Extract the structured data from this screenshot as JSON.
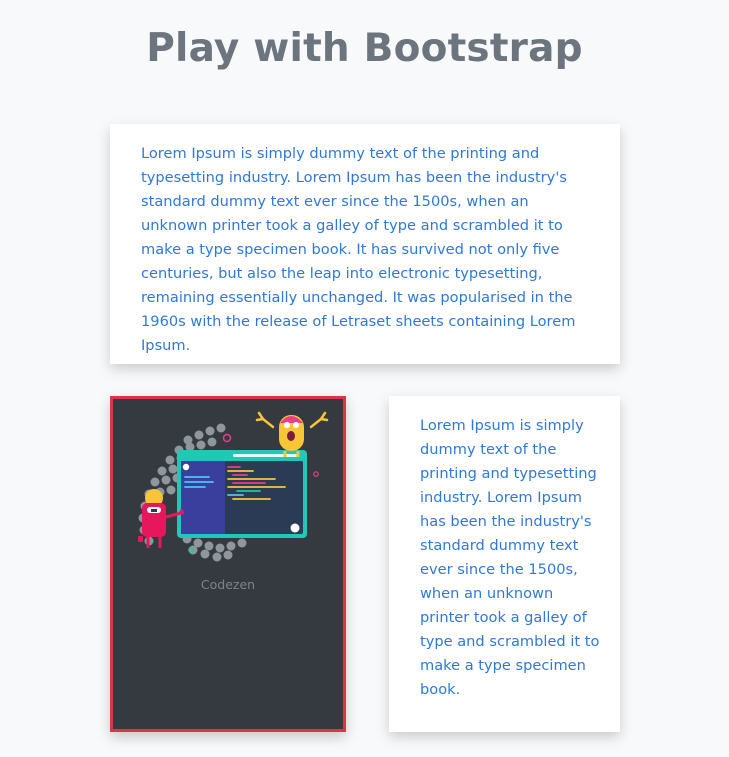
{
  "header": {
    "title": "Play with Bootstrap"
  },
  "top_card": {
    "text": "Lorem Ipsum is simply dummy text of the printing and typesetting industry. Lorem Ipsum has been the industry's standard dummy text ever since the 1500s, when an unknown printer took a galley of type and scrambled it to make a type specimen book. It has survived not only five centuries, but also the leap into electronic typesetting, remaining essentially unchanged. It was popularised in the 1960s with the release of Letraset sheets containing Lorem Ipsum."
  },
  "image_card": {
    "caption": "Codezen",
    "border_color": "#dc3545",
    "background_color": "#343a40",
    "illustration": "coding-monsters-illustration"
  },
  "right_card": {
    "text": "Lorem Ipsum is simply dummy text of the printing and typesetting industry. Lorem Ipsum has been the industry's standard dummy text ever since the 1500s, when an unknown printer took a galley of type and scrambled it to make a type specimen book."
  },
  "colors": {
    "background": "#f8f9fa",
    "title": "#6c757d",
    "body_text": "#2f79d6",
    "card": "#ffffff"
  }
}
